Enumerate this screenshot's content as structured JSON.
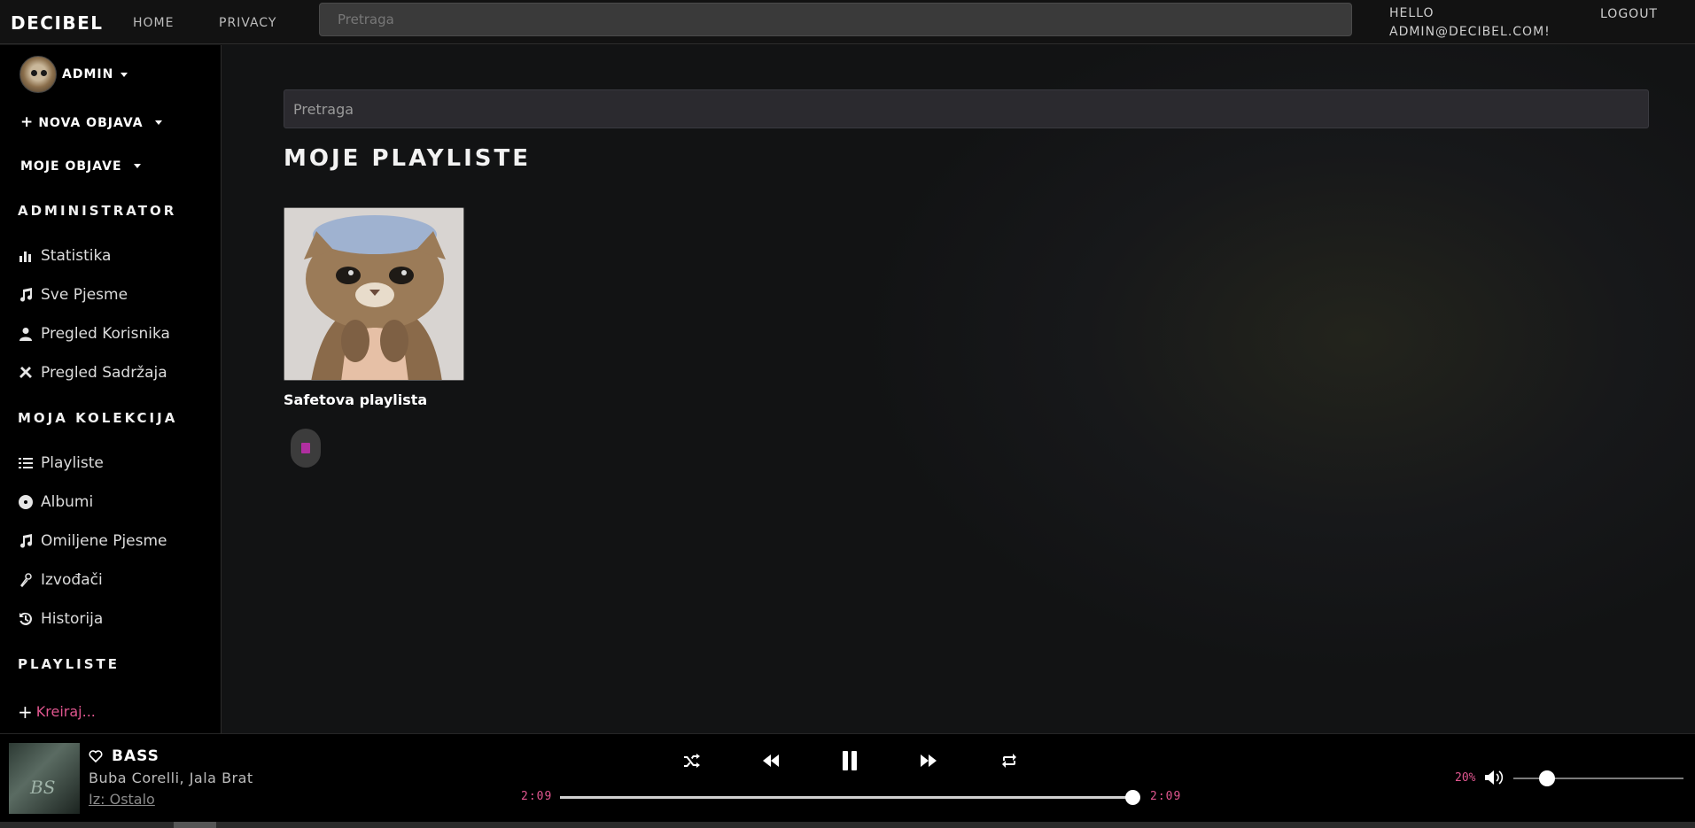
{
  "navbar": {
    "brand": "DECIBEL",
    "links": [
      "HOME",
      "PRIVACY"
    ],
    "search_placeholder": "Pretraga",
    "greeting_line1": "HELLO",
    "greeting_line2": "ADMIN@DECIBEL.COM!",
    "logout": "LOGOUT"
  },
  "sidebar": {
    "user": "ADMIN",
    "new_post": "NOVA OBJAVA",
    "my_posts": "MOJE OBJAVE",
    "admin_heading": "ADMINISTRATOR",
    "admin_items": [
      {
        "label": "Statistika",
        "icon": "chart-bar-icon"
      },
      {
        "label": "Sve Pjesme",
        "icon": "music-note-icon"
      },
      {
        "label": "Pregled Korisnika",
        "icon": "user-icon"
      },
      {
        "label": "Pregled Sadržaja",
        "icon": "tools-icon"
      }
    ],
    "collection_heading": "MOJA KOLEKCIJA",
    "collection_items": [
      {
        "label": "Playliste",
        "icon": "list-icon"
      },
      {
        "label": "Albumi",
        "icon": "disc-icon"
      },
      {
        "label": "Omiljene Pjesme",
        "icon": "music-note-icon"
      },
      {
        "label": "Izvođači",
        "icon": "microphone-icon"
      },
      {
        "label": "Historija",
        "icon": "history-icon"
      }
    ],
    "playlists_heading": "PLAYLISTE",
    "create_label": "Kreiraj..."
  },
  "main": {
    "search_placeholder": "Pretraga",
    "title": "MOJE PLAYLISTE",
    "playlists": [
      {
        "name": "Safetova playlista"
      }
    ]
  },
  "player": {
    "title": "BASS",
    "artist": "Buba Corelli, Jala Brat",
    "source": "Iz: Ostalo",
    "time_current": "2:09",
    "time_total": "2:09",
    "progress_fraction": 1.0,
    "volume_label": "20%",
    "volume_fraction": 0.2
  },
  "colors": {
    "accent": "#e0568f",
    "background": "#121212",
    "sidebar": "#000000"
  }
}
